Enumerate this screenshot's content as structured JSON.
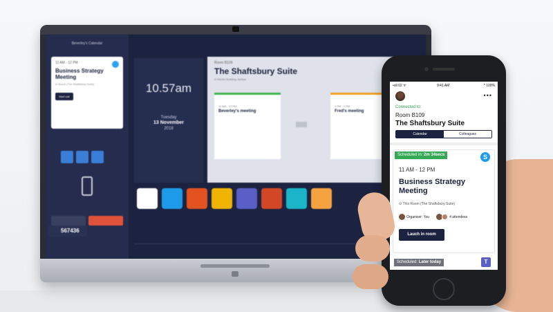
{
  "tv": {
    "left_title": "Beverley's Calendar",
    "card_time": "11 AM - 12 PM",
    "card_title": "Business Strategy Meeting",
    "card_loc": "In Room (The Shaftsbury Suite)",
    "card_btn": "Start call",
    "user_name": "Beverley Martin",
    "code": "567436",
    "time": "10.57am",
    "day": "Tuesday",
    "date": "13 November",
    "year": "2018",
    "room_label": "Room B109",
    "room_title": "The Shaftsbury Suite",
    "room_sub": "E-Interim Building, Belfast",
    "m1_time": "11 AM - 12 PM",
    "m1_name": "Beverley's meeting",
    "m2_time": "1 PM - 2 PM",
    "m2_name": "Fred's meeting"
  },
  "phone": {
    "status_left": "•ull 02 ᯤ",
    "status_time": "9:41 AM",
    "status_right": "* 100%",
    "more": "•••",
    "connected_label": "Connected to:",
    "room_code": "Room B109",
    "room_name": "The Shaftsbury Suite",
    "tabs": [
      {
        "label": "Calendar",
        "active": true
      },
      {
        "label": "Colleagues",
        "active": false
      }
    ],
    "meeting": {
      "badge_prefix": "Scheduled in: ",
      "badge_value": "2m 34secs",
      "time": "11 AM - 12 PM",
      "title": "Business Strategy Meeting",
      "location": "This Room (The Shaftsbury Suite)",
      "organiser": "Organiser: You",
      "attendees": "4 attendees",
      "launch": "Lauch in room"
    },
    "next": {
      "badge_prefix": "Scheduled: ",
      "badge_value": "Later today"
    }
  },
  "colors": {
    "navy": "#1c2340",
    "green": "#34a853",
    "skype": "#1d9bf0",
    "teams": "#5a5fc6",
    "record": "#e0533a"
  },
  "icons": [
    "skype-icon",
    "teams-icon",
    "chrome-icon",
    "office-icon",
    "location-pin-icon"
  ]
}
